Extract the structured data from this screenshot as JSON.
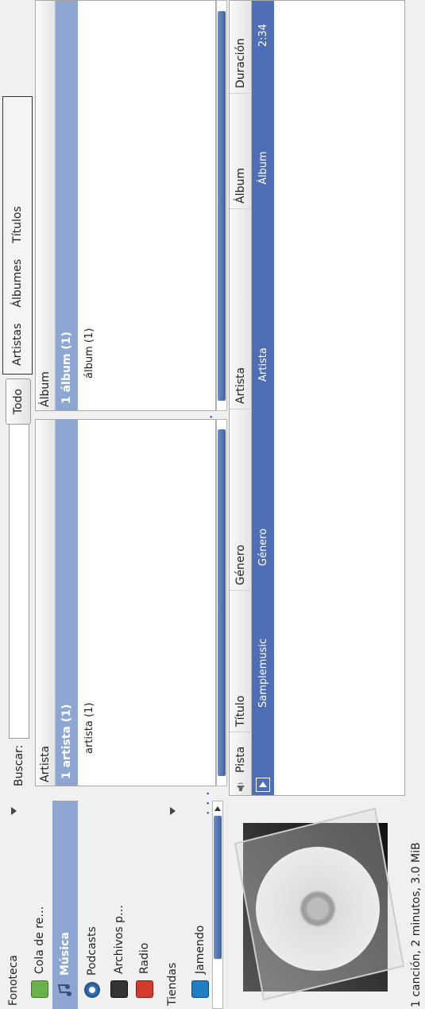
{
  "sources": {
    "library_header": "Fonoteca",
    "items": [
      {
        "label": "Cola de re…",
        "icon": "play-queue-icon"
      },
      {
        "label": "Música",
        "icon": "music-note-icon"
      },
      {
        "label": "Podcasts",
        "icon": "podcast-icon"
      },
      {
        "label": "Archivos p…",
        "icon": "document-icon"
      },
      {
        "label": "Radio",
        "icon": "radio-icon"
      }
    ],
    "stores_header": "Tiendas",
    "stores": [
      {
        "label": "Jamendo",
        "icon": "jamendo-icon"
      }
    ]
  },
  "search": {
    "label": "Buscar:",
    "value": ""
  },
  "filter": {
    "all_button": "Todo",
    "tabs": [
      "Artistas",
      "Álbumes",
      "Títulos"
    ]
  },
  "artist_browser": {
    "header": "Artista",
    "selected_row": "1 artista (1)",
    "rows": [
      "artista (1)"
    ]
  },
  "album_browser": {
    "header": "Álbum",
    "selected_row": "1 álbum (1)",
    "rows": [
      "álbum (1)"
    ]
  },
  "tracks": {
    "columns": [
      "Pista",
      "Título",
      "Género",
      "Artista",
      "Álbum",
      "Duración"
    ],
    "rows": [
      {
        "pista": "",
        "titulo": "Samplemusic",
        "genero": "Género",
        "artista": "Artista",
        "album": "Álbum",
        "duracion": "2:34"
      }
    ]
  },
  "status_bar": "1 canción, 2 minutos, 3.0 MiB",
  "colors": {
    "selection": "#4e6fb6",
    "sidebar_selection": "#8ea6d2"
  }
}
